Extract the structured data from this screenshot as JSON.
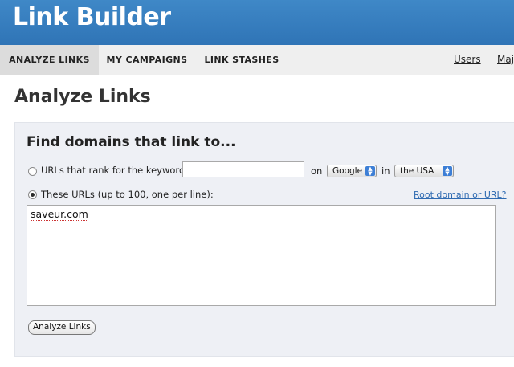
{
  "app": {
    "logo_text": "Link Builder"
  },
  "nav": {
    "tabs": [
      {
        "label": "ANALYZE LINKS",
        "active": true
      },
      {
        "label": "MY CAMPAIGNS",
        "active": false
      },
      {
        "label": "LINK STASHES",
        "active": false
      }
    ],
    "users_link": "Users",
    "partial_link": "Maje"
  },
  "page": {
    "title": "Analyze Links"
  },
  "form": {
    "heading": "Find domains that link to...",
    "option_keyword": {
      "label": "URLs that rank for the keyword",
      "selected": false,
      "keyword_value": "",
      "on_label": "on",
      "engine_value": "Google",
      "in_label": "in",
      "country_value": "the USA"
    },
    "option_urls": {
      "label": "These URLs (up to 100, one per line):",
      "selected": true,
      "help_link": "Root domain or URL?",
      "textarea_value": "saveur.com"
    },
    "submit_label": "Analyze Links"
  },
  "colors": {
    "header_blue": "#3a82c2",
    "link_blue": "#2f6bb2",
    "panel_bg": "#eef0f5"
  }
}
